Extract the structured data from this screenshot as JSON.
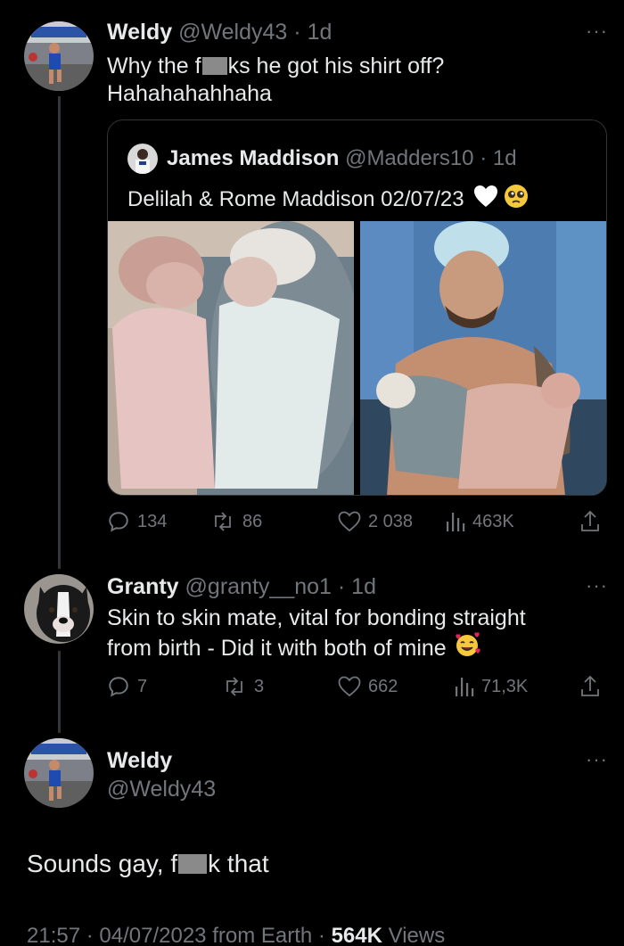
{
  "tweet1": {
    "name": "Weldy",
    "handle": "@Weldy43",
    "separator": "·",
    "time": "1d",
    "text_line1_a": "Why the f",
    "text_line1_b": "ks he got his shirt off?",
    "text_line2": "Hahahahahhaha",
    "quote": {
      "name": "James Maddison",
      "handle": "@Madders10",
      "separator": "·",
      "time": "1d",
      "text": "Delilah & Rome Maddison 02/07/23"
    },
    "stats": {
      "replies": "134",
      "retweets": "86",
      "likes": "2 038",
      "views": "463K"
    }
  },
  "tweet2": {
    "name": "Granty",
    "handle": "@granty__no1",
    "separator": "·",
    "time": "1d",
    "text_line1": "Skin to skin mate, vital for bonding straight",
    "text_line2": "from birth - Did it with both of mine",
    "stats": {
      "replies": "7",
      "retweets": "3",
      "likes": "662",
      "views": "71,3K"
    }
  },
  "tweet3": {
    "name": "Weldy",
    "handle": "@Weldy43",
    "text_a": "Sounds gay, f",
    "text_b": "k that",
    "footer": {
      "time": "21:57",
      "sep1": "·",
      "date": "04/07/2023",
      "source": "from Earth",
      "sep2": "·",
      "views": "564K",
      "views_label": "Views"
    }
  },
  "icons": {
    "reply": "reply-icon",
    "retweet": "retweet-icon",
    "like": "heart-icon",
    "views": "views-icon",
    "share": "share-icon",
    "more": "more-icon"
  },
  "colors": {
    "background": "#000000",
    "text": "#e7e9ea",
    "secondary": "#71767b",
    "border": "#2f3336"
  }
}
